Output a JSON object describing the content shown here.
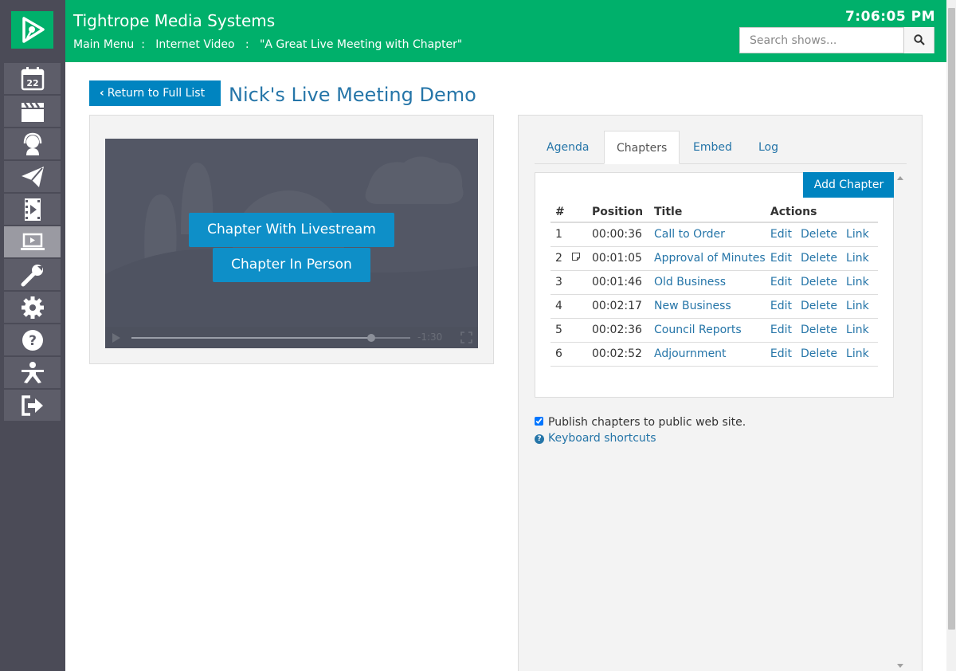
{
  "header": {
    "app_title": "Tightrope Media Systems",
    "breadcrumb": [
      "Main Menu",
      "Internet Video",
      "\"A Great Live Meeting with Chapter\""
    ],
    "clock": "7:06:05 PM",
    "search_placeholder": "Search shows..."
  },
  "sidebar": {
    "items": [
      {
        "icon": "calendar-icon",
        "label": "22"
      },
      {
        "icon": "clapperboard-icon"
      },
      {
        "icon": "headset-icon"
      },
      {
        "icon": "paper-plane-icon"
      },
      {
        "icon": "film-icon"
      },
      {
        "icon": "laptop-icon",
        "active": true
      },
      {
        "icon": "wrench-icon"
      },
      {
        "icon": "gear-icon"
      },
      {
        "icon": "question-icon"
      },
      {
        "icon": "accessibility-icon"
      },
      {
        "icon": "sign-out-icon"
      }
    ]
  },
  "page": {
    "return_label": "Return to Full List",
    "title": "Nick's Live Meeting Demo"
  },
  "video": {
    "buttons": [
      "Chapter With Livestream",
      "Chapter In Person"
    ],
    "time_remaining": "-1:30",
    "progress": 0.86
  },
  "tabs": [
    "Agenda",
    "Chapters",
    "Embed",
    "Log"
  ],
  "active_tab": "Chapters",
  "chapters": {
    "add_label": "Add Chapter",
    "columns": [
      "#",
      "Position",
      "Title",
      "Actions"
    ],
    "actions": [
      "Edit",
      "Delete",
      "Link"
    ],
    "rows": [
      {
        "num": "1",
        "position": "00:00:36",
        "title": "Call to Order",
        "note": false
      },
      {
        "num": "2",
        "position": "00:01:05",
        "title": "Approval of Minutes",
        "note": true
      },
      {
        "num": "3",
        "position": "00:01:46",
        "title": "Old Business",
        "note": false
      },
      {
        "num": "4",
        "position": "00:02:17",
        "title": "New Business",
        "note": false
      },
      {
        "num": "5",
        "position": "00:02:36",
        "title": "Council Reports",
        "note": false
      },
      {
        "num": "6",
        "position": "00:02:52",
        "title": "Adjournment",
        "note": false
      }
    ],
    "publish_label": "Publish chapters to public web site.",
    "publish_checked": true,
    "shortcuts_label": "Keyboard shortcuts"
  },
  "colors": {
    "brand_green": "#00b06b",
    "link_blue": "#2575a8",
    "button_blue": "#0084c0",
    "sidebar_bg": "#4b4b57"
  }
}
